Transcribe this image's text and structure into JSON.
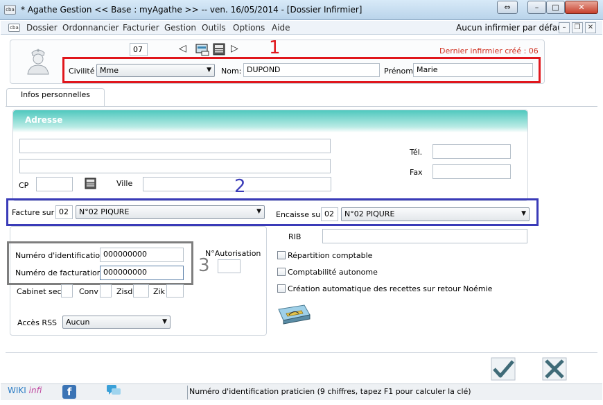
{
  "window": {
    "app_icon": "cba",
    "title": "* Agathe Gestion << Base : myAgathe >>   --   ven. 16/05/2014  - [Dossier Infirmier]",
    "restore_icon": "⇔",
    "min_icon": "–",
    "max_icon": "□",
    "close_icon": "✕"
  },
  "menu": {
    "icon": "cba",
    "items": [
      "Dossier",
      "Ordonnancier",
      "Facturier",
      "Gestion",
      "Outils",
      "Options",
      "Aide"
    ],
    "status": "Aucun infirmier par défaut",
    "mdi_min": "–",
    "mdi_restore": "❐",
    "mdi_close": "✕"
  },
  "header": {
    "record_number": "07",
    "nav_prev": "◁",
    "nav_next": "▷",
    "last_created": "Dernier infirmier créé : 06",
    "civilite_label": "Civilité",
    "civilite_value": "Mme",
    "nom_label": "Nom:",
    "nom_value": "DUPOND",
    "prenom_label": "Prénom",
    "prenom_value": "Marie"
  },
  "annotations": {
    "one": "1",
    "two": "2",
    "three": "3"
  },
  "tabs": [
    {
      "label": "Infos personnelles"
    }
  ],
  "adresse": {
    "title": "Adresse",
    "line1": "",
    "line2": "",
    "cp_label": "CP",
    "cp_value": "",
    "ville_label": "Ville",
    "ville_value": "",
    "tel_label": "Tél.",
    "tel_value": "",
    "fax_label": "Fax",
    "fax_value": ""
  },
  "billing": {
    "facture_label": "Facture sur",
    "facture_code": "02",
    "facture_value": "N°02  PIQURE",
    "encaisse_label": "Encaisse sur",
    "encaisse_code": "02",
    "encaisse_value": "N°02  PIQURE",
    "rib_label": "RIB",
    "rib_value": ""
  },
  "ident": {
    "num_ident_label": "Numéro d'identification",
    "num_ident_value": "000000000",
    "num_fact_label": "Numéro de facturation",
    "num_fact_value": "000000000",
    "autorisation_label": "N°Autorisation",
    "autorisation_value": "",
    "cabinet_label": "Cabinet sec.",
    "conv_label": "Conv",
    "zisd_label": "Zisd",
    "zik_label": "Zik",
    "rss_label": "Accès RSS",
    "rss_value": "Aucun"
  },
  "options": {
    "repartition": "Répartition comptable",
    "compta_autonome": "Comptabilité autonome",
    "creation_auto": "Création automatique des recettes sur retour Noémie"
  },
  "footer": {
    "wiki": "WIKI",
    "wiki_suffix": "infi",
    "facebook": "f",
    "status": "Numéro d'identification praticien (9 chiffres, tapez F1 pour calculer la clé)"
  },
  "colors": {
    "annotation_red": "#e0161c",
    "annotation_blue": "#3a3bb8",
    "annotation_grey": "#7e7e7e",
    "header_teal": "#4fc8be"
  }
}
